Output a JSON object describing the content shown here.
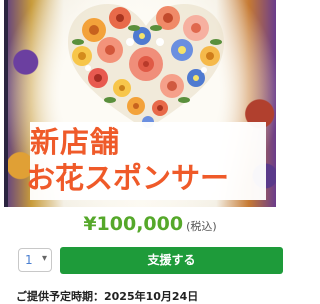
{
  "product_image": {
    "alt_label": "",
    "promo_line1": "新店舗",
    "promo_line2": "お花スポンサー",
    "promo_color": "#ef5a29"
  },
  "price": {
    "amount": "¥100,000",
    "tax_note": "(税込)",
    "color": "#55a82a"
  },
  "purchase": {
    "quantity_value": "1",
    "support_label": "支援する",
    "button_color": "#1e9b3a"
  },
  "delivery": {
    "text": "ご提供予定時期：2025年10月24日"
  }
}
